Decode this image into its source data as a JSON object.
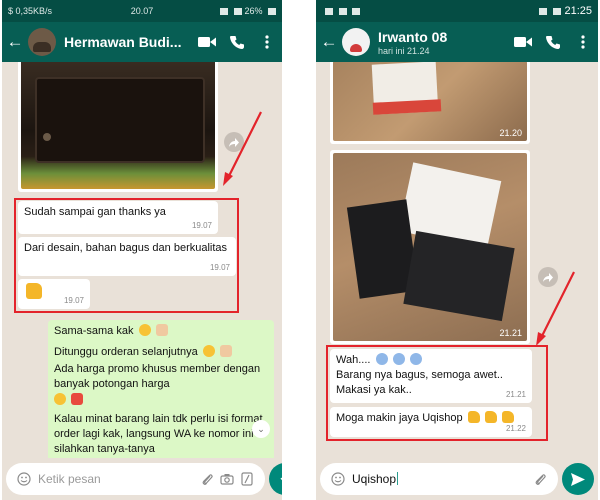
{
  "left": {
    "status": {
      "left": "$ 0,35KB/s",
      "time": "20.07",
      "battery": "26%"
    },
    "header": {
      "name": "Hermawan Budi..."
    },
    "messages": [
      {
        "text": "Sudah sampai gan thanks ya",
        "time": "19.07"
      },
      {
        "text": "Dari desain, bahan bagus dan berkualitas",
        "time": "19.07"
      },
      {
        "time": "19.07",
        "emoji": "thumbs-up"
      }
    ],
    "reply": {
      "line1": "Sama-sama kak",
      "line2": "Ditunggu orderan selanjutnya",
      "line3": "Ada harga promo khusus member dengan banyak potongan harga",
      "line4": "Kalau minat barang lain tdk perlu isi format order lagi kak, langsung WA ke nomor ini silahkan tanya-tanya"
    },
    "input": {
      "placeholder": "Ketik pesan"
    }
  },
  "right": {
    "status": {
      "time": "21:25"
    },
    "header": {
      "name": "Irwanto 08",
      "subtitle": "hari ini 21.24"
    },
    "images": [
      {
        "time": "21.20"
      },
      {
        "time": "21.21"
      }
    ],
    "messages": [
      {
        "line1": "Wah....",
        "line2": "Barang nya bagus, semoga awet..",
        "line3": "Makasi ya kak..",
        "time": "21.21"
      },
      {
        "text": "Moga makin jaya Uqishop",
        "time": "21.22"
      }
    ],
    "input": {
      "value": "Uqishop"
    }
  },
  "colors": {
    "header": "#075e54",
    "statusbar": "#054d44",
    "chat_bg": "#e9e1d8",
    "outgoing": "#dcf8c6",
    "highlight": "#e3232b",
    "accent": "#00897b"
  }
}
